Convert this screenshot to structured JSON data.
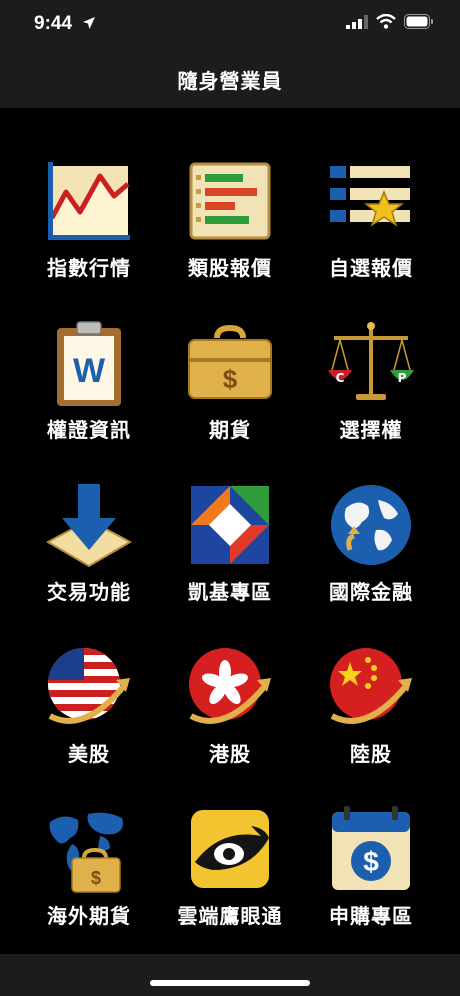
{
  "status": {
    "time": "9:44"
  },
  "header": {
    "title": "隨身營業員"
  },
  "grid": {
    "items": [
      {
        "label": "指數行情",
        "icon": "line-chart-icon"
      },
      {
        "label": "類股報價",
        "icon": "bar-chart-icon"
      },
      {
        "label": "自選報價",
        "icon": "star-list-icon"
      },
      {
        "label": "權證資訊",
        "icon": "clipboard-w-icon"
      },
      {
        "label": "期貨",
        "icon": "briefcase-icon"
      },
      {
        "label": "選擇權",
        "icon": "scale-icon"
      },
      {
        "label": "交易功能",
        "icon": "download-arrow-icon"
      },
      {
        "label": "凱基專區",
        "icon": "kgi-logo-icon"
      },
      {
        "label": "國際金融",
        "icon": "globe-icon"
      },
      {
        "label": "美股",
        "icon": "us-flag-icon"
      },
      {
        "label": "港股",
        "icon": "hk-flag-icon"
      },
      {
        "label": "陸股",
        "icon": "cn-flag-icon"
      },
      {
        "label": "海外期貨",
        "icon": "world-briefcase-icon"
      },
      {
        "label": "雲端鷹眼通",
        "icon": "eagle-eye-icon"
      },
      {
        "label": "申購專區",
        "icon": "calendar-dollar-icon"
      }
    ]
  },
  "colors": {
    "background": "#000000",
    "bar": "#1c1c1c",
    "gold": "#e2b14a",
    "red": "#d32222",
    "blue": "#1b5fae"
  }
}
